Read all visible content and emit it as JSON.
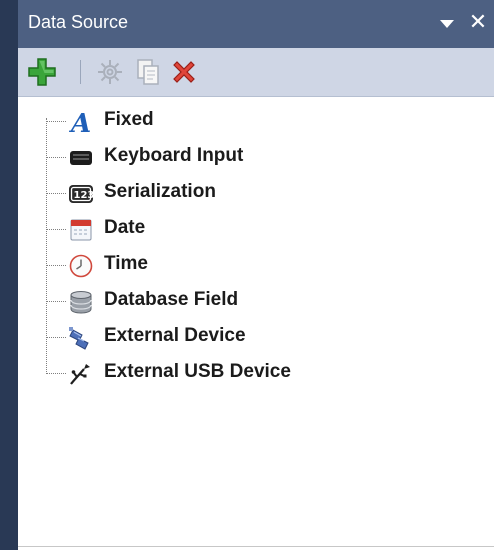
{
  "panel": {
    "title": "Data Source"
  },
  "toolbar": {
    "buttons": [
      {
        "icon": "add-icon",
        "enabled": true
      },
      {
        "icon": "settings-icon",
        "enabled": false
      },
      {
        "icon": "copy-icon",
        "enabled": false
      },
      {
        "icon": "delete-icon",
        "enabled": true
      }
    ]
  },
  "tree": {
    "items": [
      {
        "label": "Fixed",
        "icon": "fixed-text-icon"
      },
      {
        "label": "Keyboard Input",
        "icon": "keyboard-icon"
      },
      {
        "label": "Serialization",
        "icon": "serialization-icon"
      },
      {
        "label": "Date",
        "icon": "calendar-icon"
      },
      {
        "label": "Time",
        "icon": "clock-icon"
      },
      {
        "label": "Database Field",
        "icon": "database-icon"
      },
      {
        "label": "External Device",
        "icon": "external-device-icon"
      },
      {
        "label": "External USB Device",
        "icon": "usb-icon"
      }
    ]
  },
  "colors": {
    "title_bar": "#4d6082",
    "toolbar": "#cfd6e5",
    "window_edge": "#293955"
  }
}
